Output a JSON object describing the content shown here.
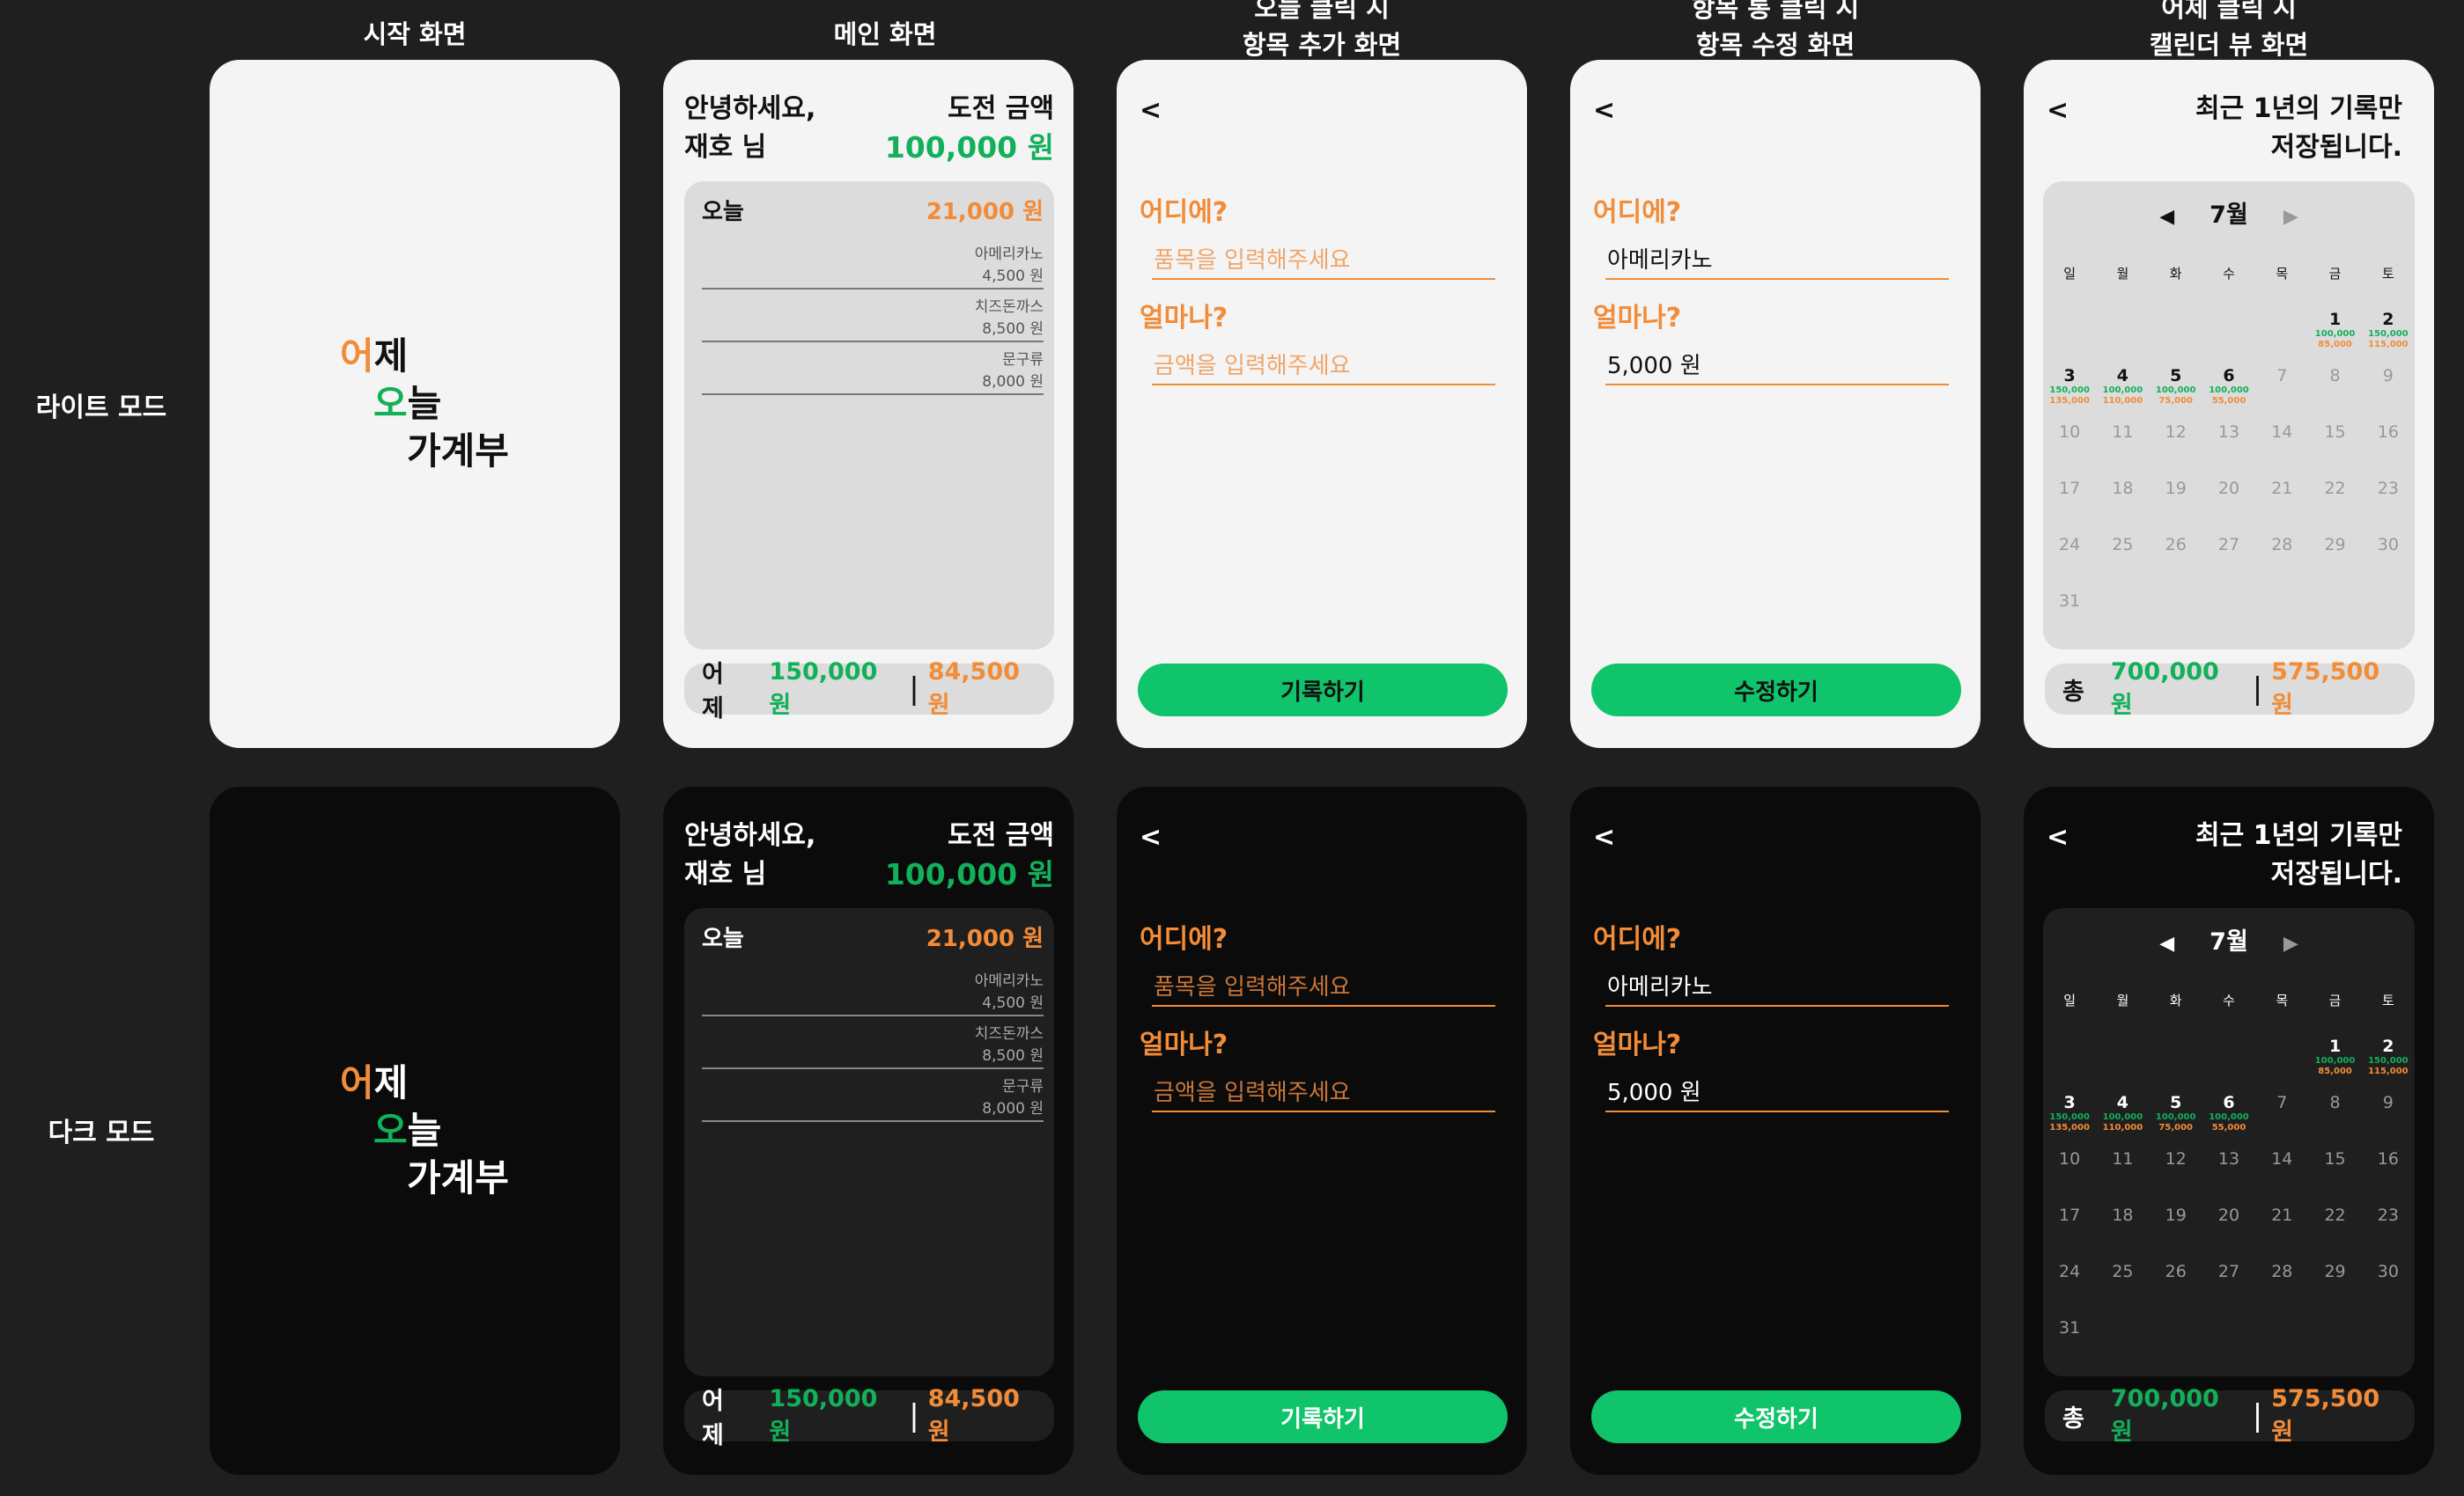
{
  "columns": [
    "시작 화면",
    "메인 화면",
    "오늘 클릭 시\n항목 추가 화면",
    "항목 통 클릭 시\n항목 수정 화면",
    "어제 클릭 시\n캘린더 뷰 화면"
  ],
  "rows": [
    "라이트 모드",
    "다크 모드"
  ],
  "start": {
    "line1": "어제",
    "line2": "오늘",
    "line3": "가계부",
    "accent1": "어",
    "rest1": "제",
    "accent2": "오",
    "rest2": "늘"
  },
  "main": {
    "greeting1": "안녕하세요,",
    "greeting2": "재호 님",
    "goal_label": "도전 금액",
    "goal_amount": "100,000 원",
    "today_label": "오늘",
    "today_total": "21,000 원",
    "items": [
      {
        "name": "아메리카노",
        "price": "4,500 원"
      },
      {
        "name": "치즈돈까스",
        "price": "8,500 원"
      },
      {
        "name": "문구류",
        "price": "8,000 원"
      }
    ],
    "yesterday_label": "어제",
    "yesterday_goal": "150,000 원",
    "yesterday_spent": "84,500 원"
  },
  "add": {
    "back": "<",
    "where_label": "어디에?",
    "where_placeholder": "품목을 입력해주세요",
    "amount_label": "얼마나?",
    "amount_placeholder": "금액을 입력해주세요",
    "button": "기록하기"
  },
  "edit": {
    "back": "<",
    "where_label": "어디에?",
    "where_value": "아메리카노",
    "amount_label": "얼마나?",
    "amount_value": "5,000 원",
    "button": "수정하기"
  },
  "calendar": {
    "back": "<",
    "note1": "최근 1년의 기록만",
    "note2": "저장됩니다.",
    "prev": "◀",
    "month": "7월",
    "next": "▶",
    "weekdays": [
      "일",
      "월",
      "화",
      "수",
      "목",
      "금",
      "토"
    ],
    "days": [
      {
        "d": "",
        "a": "",
        "b": ""
      },
      {
        "d": "",
        "a": "",
        "b": ""
      },
      {
        "d": "",
        "a": "",
        "b": ""
      },
      {
        "d": "",
        "a": "",
        "b": ""
      },
      {
        "d": "",
        "a": "",
        "b": ""
      },
      {
        "d": "1",
        "a": "100,000",
        "b": "85,000"
      },
      {
        "d": "2",
        "a": "150,000",
        "b": "115,000"
      },
      {
        "d": "3",
        "a": "150,000",
        "b": "135,000"
      },
      {
        "d": "4",
        "a": "100,000",
        "b": "110,000"
      },
      {
        "d": "5",
        "a": "100,000",
        "b": "75,000"
      },
      {
        "d": "6",
        "a": "100,000",
        "b": "55,000"
      },
      {
        "d": "7",
        "a": "",
        "b": ""
      },
      {
        "d": "8",
        "a": "",
        "b": ""
      },
      {
        "d": "9",
        "a": "",
        "b": ""
      },
      {
        "d": "10",
        "a": "",
        "b": ""
      },
      {
        "d": "11",
        "a": "",
        "b": ""
      },
      {
        "d": "12",
        "a": "",
        "b": ""
      },
      {
        "d": "13",
        "a": "",
        "b": ""
      },
      {
        "d": "14",
        "a": "",
        "b": ""
      },
      {
        "d": "15",
        "a": "",
        "b": ""
      },
      {
        "d": "16",
        "a": "",
        "b": ""
      },
      {
        "d": "17",
        "a": "",
        "b": ""
      },
      {
        "d": "18",
        "a": "",
        "b": ""
      },
      {
        "d": "19",
        "a": "",
        "b": ""
      },
      {
        "d": "20",
        "a": "",
        "b": ""
      },
      {
        "d": "21",
        "a": "",
        "b": ""
      },
      {
        "d": "22",
        "a": "",
        "b": ""
      },
      {
        "d": "23",
        "a": "",
        "b": ""
      },
      {
        "d": "24",
        "a": "",
        "b": ""
      },
      {
        "d": "25",
        "a": "",
        "b": ""
      },
      {
        "d": "26",
        "a": "",
        "b": ""
      },
      {
        "d": "27",
        "a": "",
        "b": ""
      },
      {
        "d": "28",
        "a": "",
        "b": ""
      },
      {
        "d": "29",
        "a": "",
        "b": ""
      },
      {
        "d": "30",
        "a": "",
        "b": ""
      },
      {
        "d": "31",
        "a": "",
        "b": ""
      }
    ],
    "total_label": "총",
    "total_goal": "700,000 원",
    "total_spent": "575,500 원"
  },
  "colors": {
    "green": "#12b05a",
    "orange": "#f28c38",
    "button": "#0fc46a",
    "light_bg": "#f4f4f4",
    "dark_bg": "#0b0b0b",
    "page_bg": "#1f1f1f"
  }
}
